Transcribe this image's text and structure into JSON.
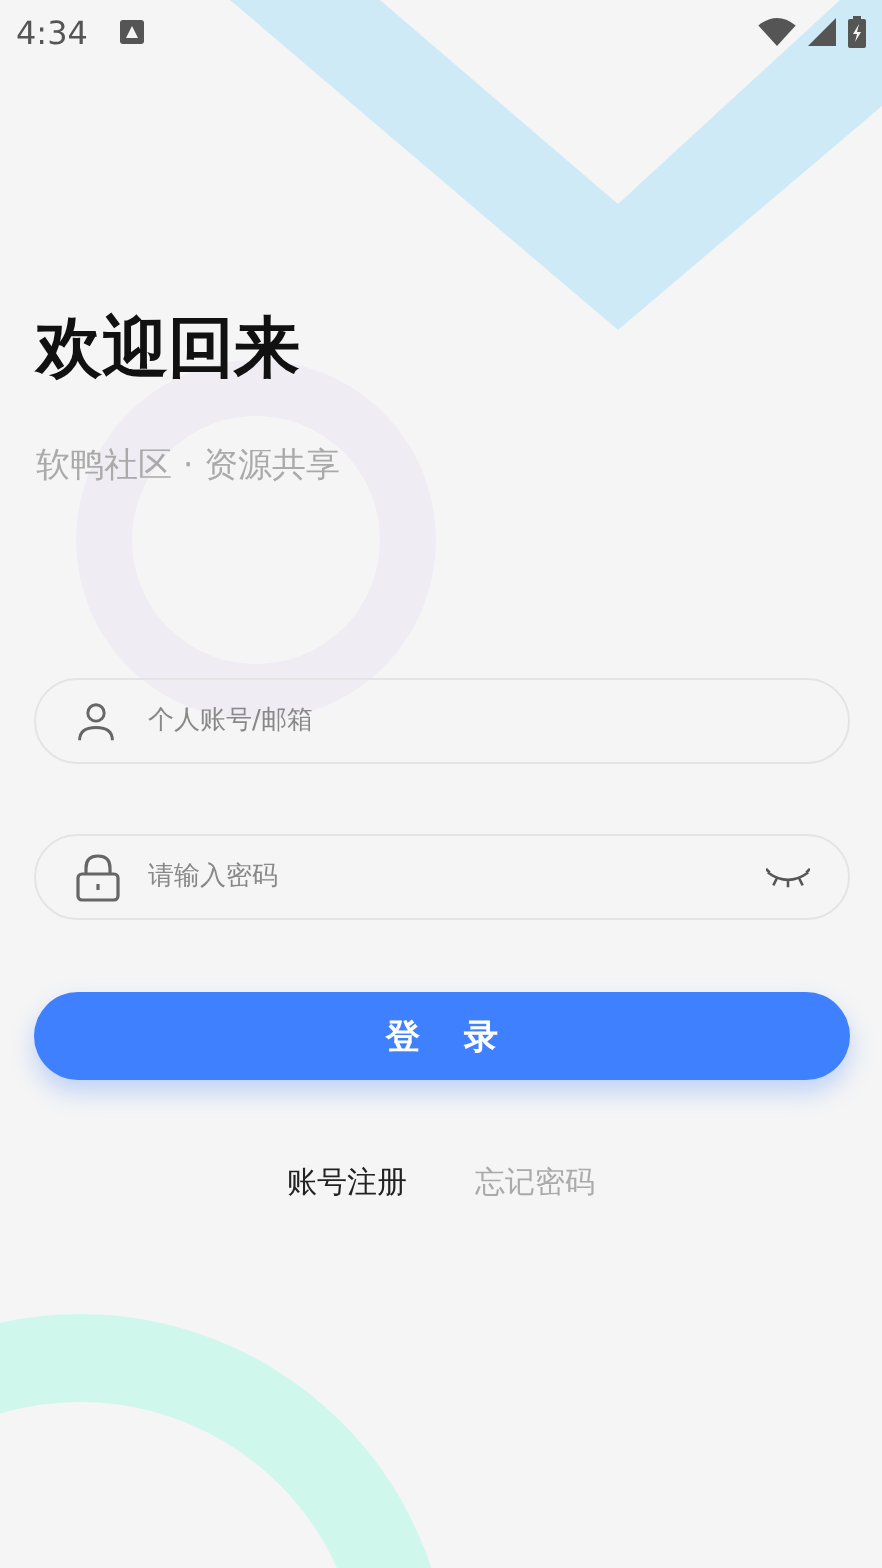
{
  "status_bar": {
    "time": "4:34"
  },
  "title": "欢迎回来",
  "subtitle": "软鸭社区 · 资源共享",
  "fields": [
    {
      "kind": "account",
      "placeholder": "个人账号/邮箱"
    },
    {
      "kind": "password",
      "placeholder": "请输入密码"
    }
  ],
  "login_button": "登 录",
  "links": [
    {
      "label": "账号注册",
      "kind": "primary"
    },
    {
      "label": "忘记密码",
      "kind": "secondary"
    }
  ]
}
